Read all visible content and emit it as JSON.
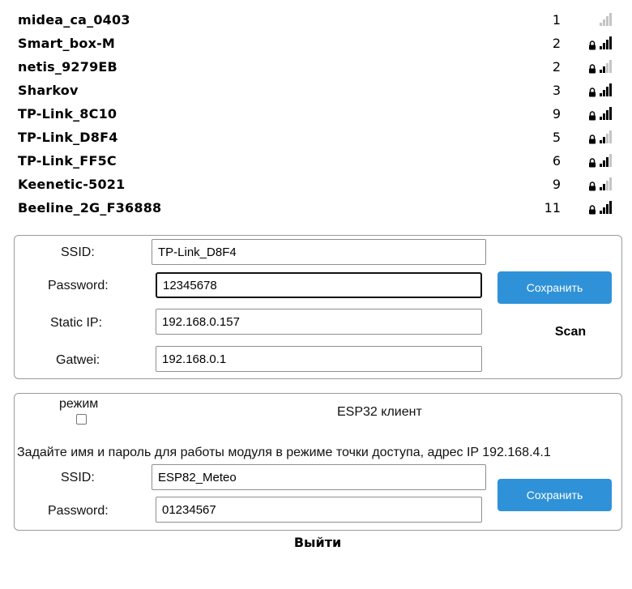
{
  "networks": [
    {
      "ssid": "midea_ca_0403",
      "channel": "1",
      "secured": false,
      "signal": 0
    },
    {
      "ssid": "Smart_box-M",
      "channel": "2",
      "secured": true,
      "signal": 4
    },
    {
      "ssid": "netis_9279EB",
      "channel": "2",
      "secured": true,
      "signal": 2
    },
    {
      "ssid": "Sharkov",
      "channel": "3",
      "secured": true,
      "signal": 4
    },
    {
      "ssid": "TP-Link_8C10",
      "channel": "9",
      "secured": true,
      "signal": 4
    },
    {
      "ssid": "TP-Link_D8F4",
      "channel": "5",
      "secured": true,
      "signal": 2
    },
    {
      "ssid": "TP-Link_FF5C",
      "channel": "6",
      "secured": true,
      "signal": 3
    },
    {
      "ssid": "Keenetic-5021",
      "channel": "9",
      "secured": true,
      "signal": 2
    },
    {
      "ssid": "Beeline_2G_F36888",
      "channel": "11",
      "secured": true,
      "signal": 4
    }
  ],
  "station_form": {
    "ssid_label": "SSID:",
    "ssid_value": "TP-Link_D8F4",
    "password_label": "Password:",
    "password_value": "12345678",
    "static_ip_label": "Static IP:",
    "static_ip_value": "192.168.0.157",
    "gateway_label": "Gatwei:",
    "gateway_value": "192.168.0.1",
    "save_label": "Сохранить",
    "scan_label": "Scan"
  },
  "ap_form": {
    "mode_label": "режим",
    "mode_checked": false,
    "mode_name": "ESP32 клиент",
    "hint": "Задайте имя и пароль для работы модуля в режиме точки доступа, адрес IP 192.168.4.1",
    "ssid_label": "SSID:",
    "ssid_value": "ESP82_Meteo",
    "password_label": "Password:",
    "password_value": "01234567",
    "save_label": "Сохранить"
  },
  "exit_label": "Выйти",
  "colors": {
    "button": "#2f92d8",
    "signal_on": "#000000",
    "signal_off": "#c4c4c4"
  },
  "icons": {
    "lock": "lock-icon",
    "signal": "wifi-signal-icon"
  }
}
